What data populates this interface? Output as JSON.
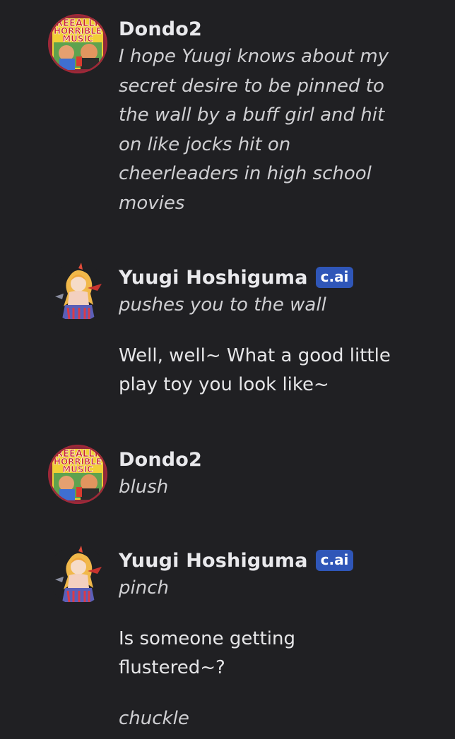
{
  "messages": [
    {
      "sender": "Dondo2",
      "avatar_icon": "album-cover-avatar",
      "badge": null,
      "paragraphs": [
        {
          "italic": true,
          "lines": [
            "I hope Yuugi knows about my",
            "secret desire to be pinned to",
            "the wall by a buff girl and hit",
            "on like jocks hit on",
            "cheerleaders in high school",
            "movies"
          ]
        }
      ]
    },
    {
      "sender": "Yuugi Hoshiguma",
      "avatar_icon": "anime-character-avatar",
      "badge": "c.ai",
      "paragraphs": [
        {
          "italic": true,
          "lines": [
            "pushes you to the wall"
          ]
        },
        {
          "italic": false,
          "lines": [
            "Well, well~ What a good little",
            "play toy you look like~"
          ]
        }
      ]
    },
    {
      "sender": "Dondo2",
      "avatar_icon": "album-cover-avatar",
      "badge": null,
      "paragraphs": [
        {
          "italic": true,
          "lines": [
            "blush"
          ]
        }
      ]
    },
    {
      "sender": "Yuugi Hoshiguma",
      "avatar_icon": "anime-character-avatar",
      "badge": "c.ai",
      "paragraphs": [
        {
          "italic": true,
          "lines": [
            "pinch"
          ]
        },
        {
          "italic": false,
          "lines": [
            "Is someone getting",
            "flustered~?"
          ]
        },
        {
          "italic": true,
          "lines": [
            "chuckle"
          ]
        }
      ]
    }
  ],
  "album_cover_text": [
    "REEALLY",
    "HORRIBLE",
    "MUSIC"
  ],
  "colors": {
    "background": "#202023",
    "badge": "#2f56b8",
    "name": "#e9e9ec",
    "italic_text": "#cfcfd2"
  }
}
